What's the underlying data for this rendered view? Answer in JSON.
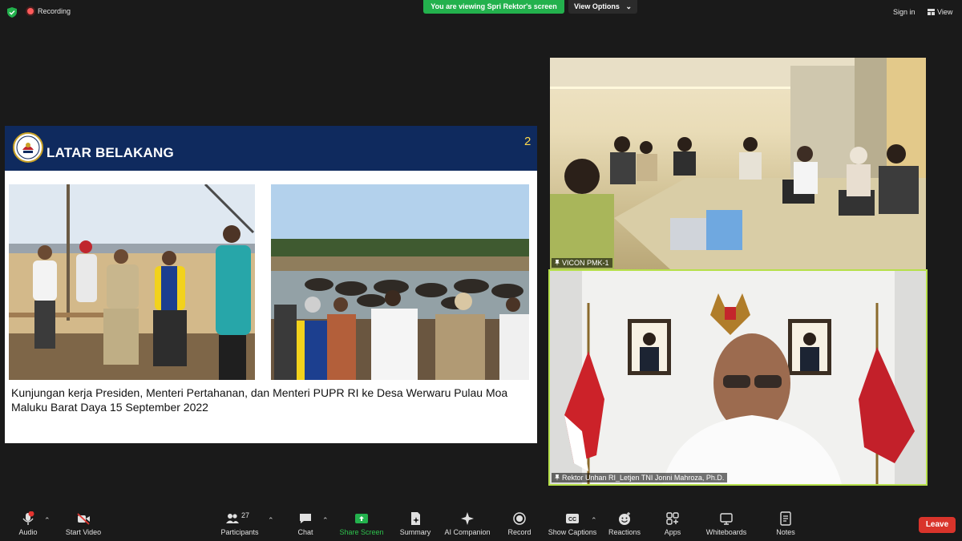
{
  "topbar": {
    "recording_label": "Recording",
    "viewing_banner": "You are viewing Spri Rektor's screen",
    "view_options_label": "View Options",
    "signin_label": "Sign in",
    "view_label": "View"
  },
  "slide": {
    "title": "LATAR BELAKANG",
    "page_number": "2",
    "caption": "Kunjungan kerja Presiden, Menteri Pertahanan, dan Menteri PUPR RI ke Desa Werwaru Pulau Moa Maluku Barat Daya 15 September 2022"
  },
  "participants_video": [
    {
      "name": "VICON PMK-1"
    },
    {
      "name": "Rektor Unhan RI_Letjen TNI Jonni Mahroza, Ph.D."
    }
  ],
  "toolbar": {
    "audio": "Audio",
    "start_video": "Start Video",
    "participants": "Participants",
    "participants_count": "27",
    "chat": "Chat",
    "share_screen": "Share Screen",
    "summary": "Summary",
    "ai_companion": "AI Companion",
    "record": "Record",
    "show_captions": "Show Captions",
    "reactions": "Reactions",
    "apps": "Apps",
    "whiteboards": "Whiteboards",
    "notes": "Notes",
    "leave": "Leave"
  },
  "colors": {
    "banner_green": "#23b14d",
    "leave_red": "#d9342b",
    "active_speaker_border": "#b6e04a",
    "slide_header": "#0f2a5e"
  }
}
